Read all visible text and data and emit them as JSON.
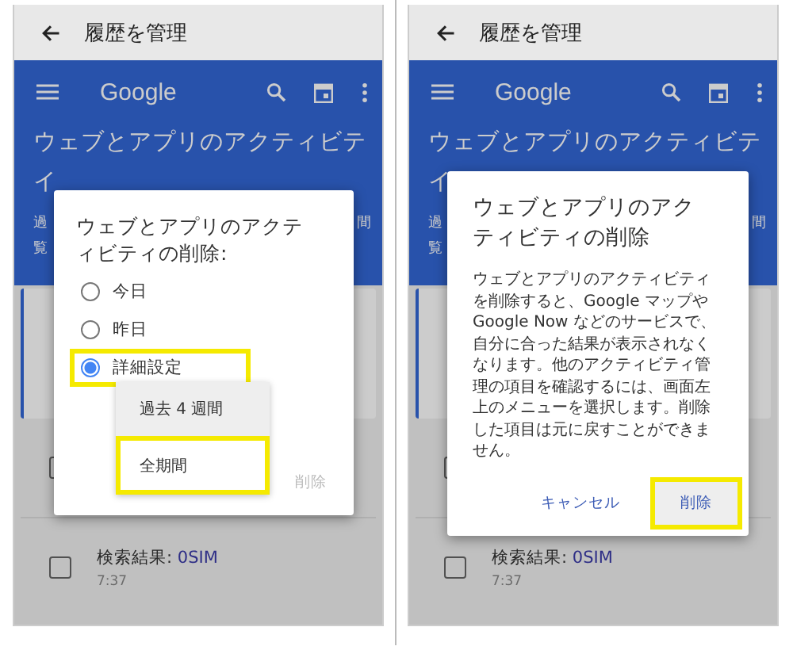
{
  "panels": [
    {
      "app_bar": {
        "title": "履歴を管理"
      },
      "header": {
        "logo": "Google",
        "title_lines": [
          "ウェブとアプリのアクティビテ",
          "イ"
        ],
        "description_left": [
          "過",
          "覧"
        ],
        "description_right": "間"
      },
      "rows": [
        {
          "checked": false
        },
        {
          "checked": false,
          "title": "検索結果: ",
          "link": "0SIM",
          "time": "7:37"
        }
      ],
      "dialog": {
        "kind": "options",
        "title": "ウェブとアプリのアクティビティの削除:",
        "options": [
          {
            "label": "今日",
            "selected": false,
            "highlighted": false
          },
          {
            "label": "昨日",
            "selected": false,
            "highlighted": false
          },
          {
            "label": "詳細設定",
            "selected": true,
            "highlighted": true
          }
        ],
        "menu": [
          {
            "label": "過去 4 週間",
            "selected": true,
            "highlighted": false
          },
          {
            "label": "全期間",
            "selected": false,
            "highlighted": true
          }
        ],
        "actions": [
          {
            "label": "削除",
            "disabled": true,
            "highlighted": false
          }
        ]
      }
    },
    {
      "app_bar": {
        "title": "履歴を管理"
      },
      "header": {
        "logo": "Google",
        "title_lines": [
          "ウェブとアプリのアクティビテ",
          "イ"
        ],
        "description_left": [
          "過",
          "覧"
        ],
        "description_right": "間"
      },
      "rows": [
        {
          "checked": false
        },
        {
          "checked": false,
          "title": "検索結果: ",
          "link": "0SIM",
          "time": "7:37"
        }
      ],
      "dialog": {
        "kind": "confirm",
        "title": "ウェブとアプリのアクティビティの削除",
        "body": "ウェブとアプリのアクティビティを削除すると、Google マップや Google Now などのサービスで、自分に合った結果が表示されなくなります。他のアクティビティ管理の項目を確認するには、画面左上のメニューを選択します。削除した項目は元に戻すことができません。",
        "actions": [
          {
            "label": "キャンセル",
            "disabled": false,
            "highlighted": false
          },
          {
            "label": "削除",
            "disabled": false,
            "highlighted": true
          }
        ]
      }
    }
  ]
}
